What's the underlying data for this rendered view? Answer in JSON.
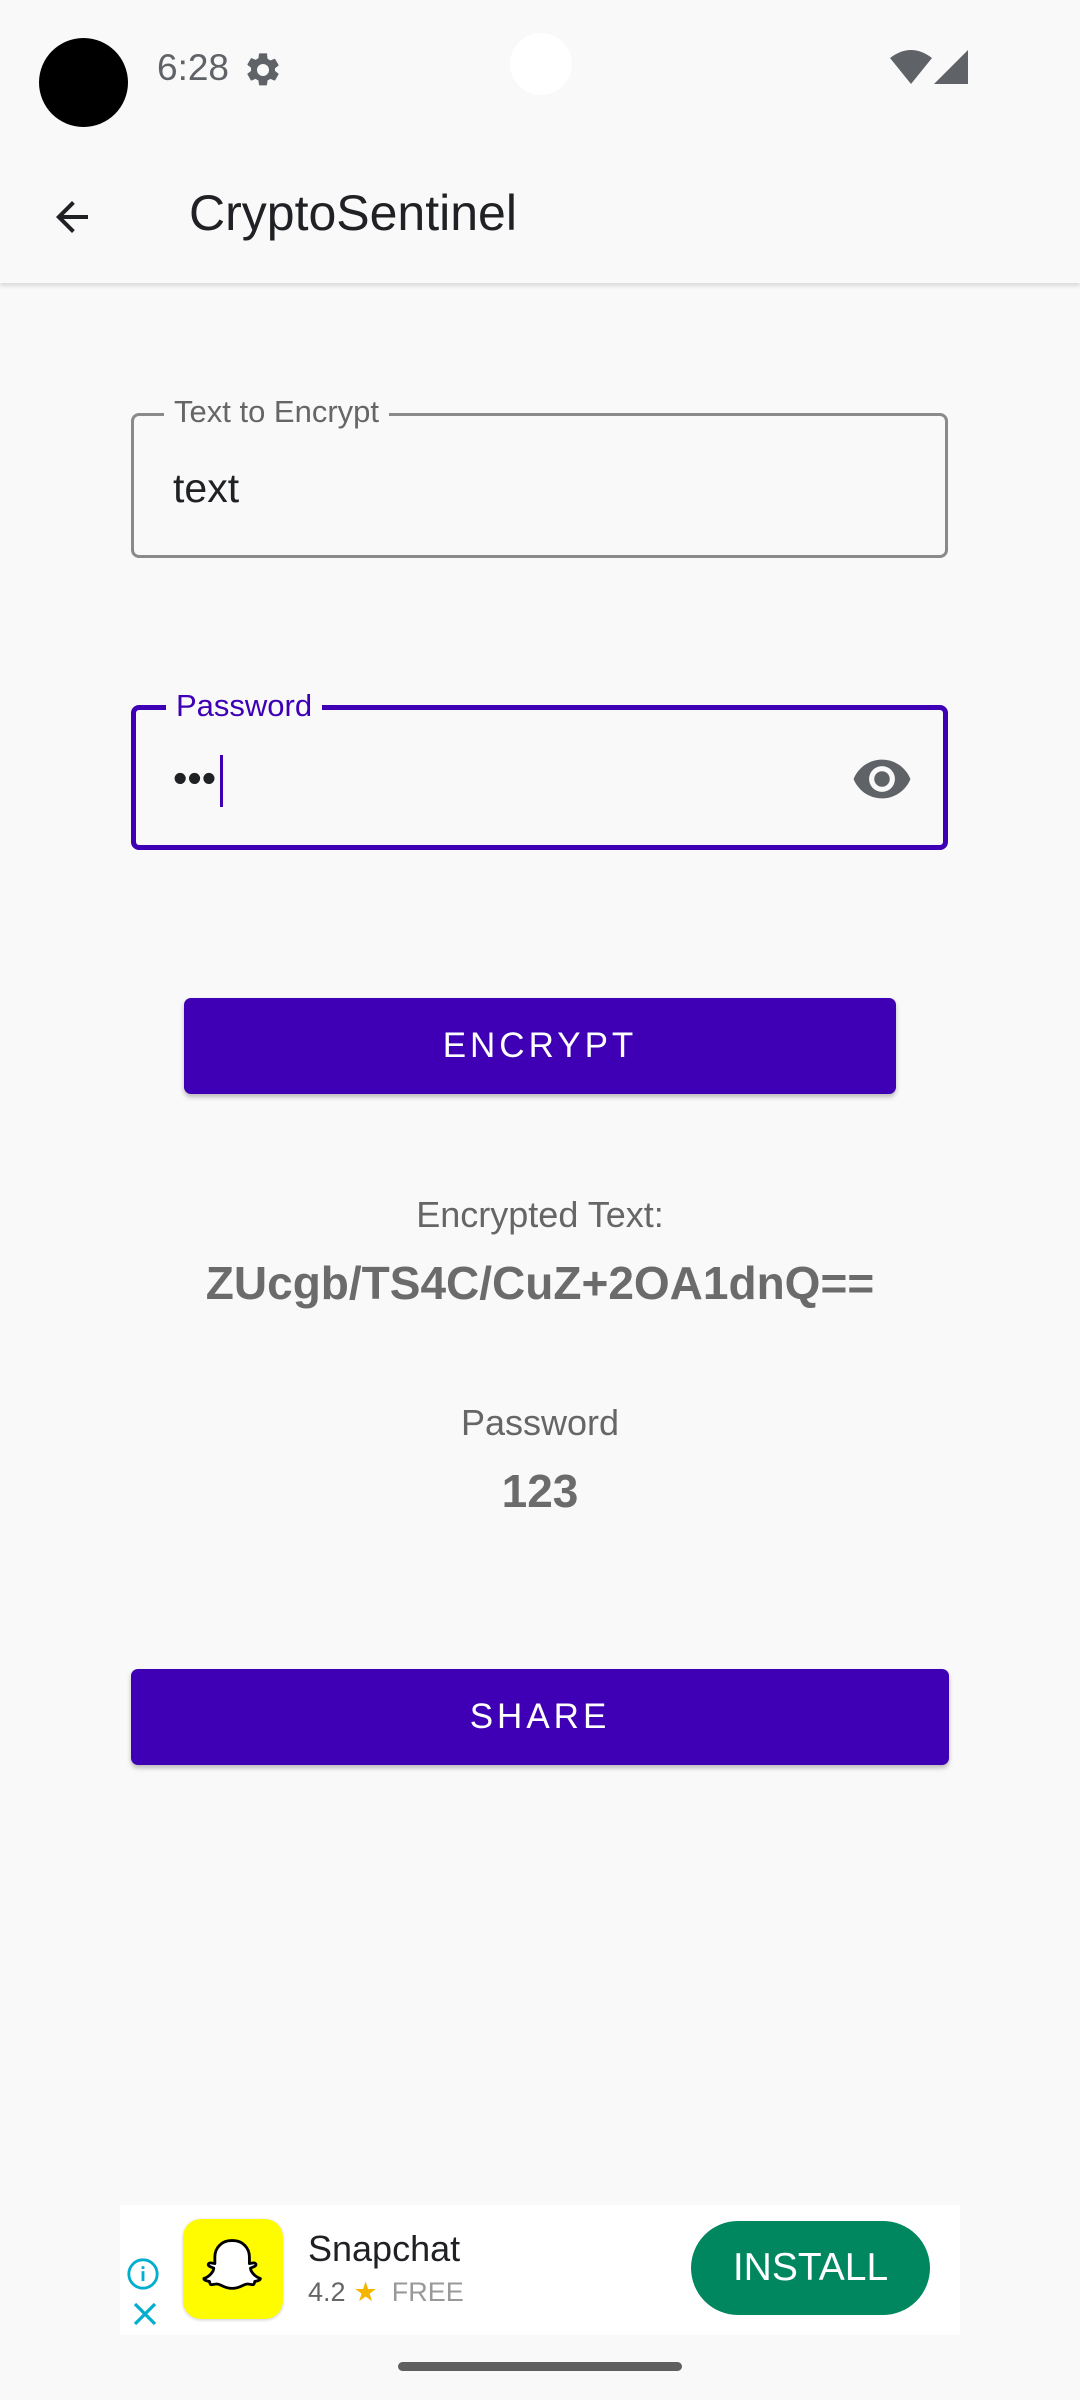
{
  "status_bar": {
    "time": "6:28",
    "settings_icon": "gear-icon",
    "wifi_icon": "wifi-icon",
    "signal_icon": "cell-signal-icon"
  },
  "app_bar": {
    "title": "CryptoSentinel",
    "back_icon": "arrow-back-icon"
  },
  "form": {
    "text_field": {
      "label": "Text to Encrypt",
      "value": "text"
    },
    "password_field": {
      "label": "Password",
      "masked_value": "•••",
      "toggle_icon": "eye-icon"
    },
    "encrypt_button": "ENCRYPT"
  },
  "result": {
    "encrypted_label": "Encrypted Text:",
    "encrypted_value": "ZUcgb/TS4C/CuZ+2OA1dnQ==",
    "password_label": "Password",
    "password_value": "123"
  },
  "share_button": "SHARE",
  "ad": {
    "app_name": "Snapchat",
    "rating": "4.2",
    "price": "FREE",
    "install_label": "INSTALL"
  },
  "colors": {
    "accent": "#3f00b5",
    "install_green": "#01875f",
    "snapchat_yellow": "#fffc00",
    "background": "#f9f9f9"
  }
}
